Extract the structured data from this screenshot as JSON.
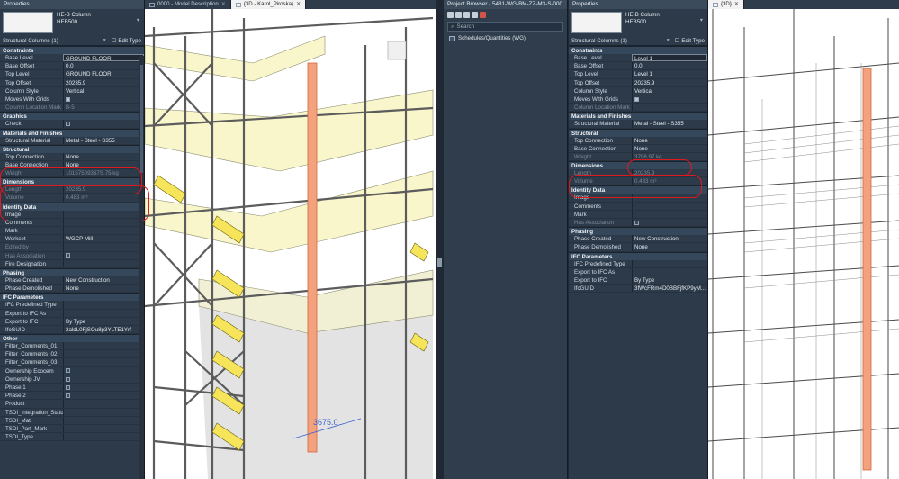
{
  "left_props": {
    "title": "Properties",
    "type_name": "HE-B Column",
    "type_sub": "HEB500",
    "filter": "Structural Columns (1)",
    "edit_type": "Edit Type",
    "sections": [
      {
        "name": "Constraints",
        "rows": [
          {
            "k": "Base Level",
            "v": "GROUND FLOOR",
            "boxed": true
          },
          {
            "k": "Base Offset",
            "v": "0.0"
          },
          {
            "k": "Top Level",
            "v": "GROUND FLOOR"
          },
          {
            "k": "Top Offset",
            "v": "20235.9"
          },
          {
            "k": "Column Style",
            "v": "Vertical"
          },
          {
            "k": "Moves With Grids",
            "v": "",
            "check": true
          },
          {
            "k": "Column Location Mark",
            "v": "B-5",
            "dim": true
          }
        ]
      },
      {
        "name": "Graphics",
        "rows": [
          {
            "k": "Check",
            "v": "",
            "check": false
          }
        ]
      },
      {
        "name": "Materials and Finishes",
        "rows": [
          {
            "k": "Structural Material",
            "v": "Metal - Steel - S355"
          }
        ]
      },
      {
        "name": "Structural",
        "rows": [
          {
            "k": "Top Connection",
            "v": "None"
          },
          {
            "k": "Base Connection",
            "v": "None"
          },
          {
            "k": "Weight",
            "v": "10157509367S.75 kg",
            "dim": true
          }
        ]
      },
      {
        "name": "Dimensions",
        "rows": [
          {
            "k": "Length",
            "v": "20235.9",
            "dim": true
          },
          {
            "k": "Volume",
            "v": "0.483 m³",
            "dim": true
          }
        ]
      },
      {
        "name": "Identity Data",
        "rows": [
          {
            "k": "Image",
            "v": ""
          },
          {
            "k": "Comments",
            "v": ""
          },
          {
            "k": "Mark",
            "v": ""
          },
          {
            "k": "Workset",
            "v": "WGCP Mill"
          },
          {
            "k": "Edited by",
            "v": "",
            "dim": true
          },
          {
            "k": "Has Association",
            "v": "",
            "check": false,
            "dim": true
          },
          {
            "k": "Fire Designation",
            "v": ""
          }
        ]
      },
      {
        "name": "Phasing",
        "rows": [
          {
            "k": "Phase Created",
            "v": "New Construction"
          },
          {
            "k": "Phase Demolished",
            "v": "None"
          }
        ]
      },
      {
        "name": "IFC Parameters",
        "rows": [
          {
            "k": "IFC Predefined Type",
            "v": ""
          },
          {
            "k": "Export to IFC As",
            "v": ""
          },
          {
            "k": "Export to IFC",
            "v": "By Type"
          },
          {
            "k": "IfcGUID",
            "v": "2aldL0FjSOu8p3YLTE1Yrf"
          }
        ]
      },
      {
        "name": "Other",
        "rows": [
          {
            "k": "Filter_Comments_01",
            "v": ""
          },
          {
            "k": "Filter_Comments_02",
            "v": ""
          },
          {
            "k": "Filter_Comments_03",
            "v": ""
          },
          {
            "k": "Ownership Ecocem",
            "v": "",
            "check": false
          },
          {
            "k": "Ownership JV",
            "v": "",
            "check": false
          },
          {
            "k": "Phase 1",
            "v": "",
            "check": false
          },
          {
            "k": "Phase 2",
            "v": "",
            "check": false
          },
          {
            "k": "Product",
            "v": ""
          },
          {
            "k": "TSDI_Integration_Status",
            "v": ""
          },
          {
            "k": "TSDI_Matl",
            "v": ""
          },
          {
            "k": "TSDI_Part_Mark",
            "v": ""
          },
          {
            "k": "TSDI_Type",
            "v": ""
          }
        ]
      }
    ]
  },
  "right_props": {
    "title": "Properties",
    "type_name": "HE-B Column",
    "type_sub": "HEB500",
    "filter": "Structural Columns (1)",
    "edit_type": "Edit Type",
    "sections": [
      {
        "name": "Constraints",
        "rows": [
          {
            "k": "Base Level",
            "v": "Level 1",
            "boxed": true
          },
          {
            "k": "Base Offset",
            "v": "0.0"
          },
          {
            "k": "Top Level",
            "v": "Level 1"
          },
          {
            "k": "Top Offset",
            "v": "20235.9"
          },
          {
            "k": "Column Style",
            "v": "Vertical"
          },
          {
            "k": "Moves With Grids",
            "v": "",
            "check": true
          },
          {
            "k": "Column Location Mark",
            "v": "",
            "dim": true
          }
        ]
      },
      {
        "name": "Materials and Finishes",
        "rows": [
          {
            "k": "Structural Material",
            "v": "Metal - Steel - S355"
          }
        ]
      },
      {
        "name": "Structural",
        "rows": [
          {
            "k": "Top Connection",
            "v": "None"
          },
          {
            "k": "Base Connection",
            "v": "None"
          },
          {
            "k": "Weight",
            "v": "3796.97 kg",
            "dim": true
          }
        ]
      },
      {
        "name": "Dimensions",
        "rows": [
          {
            "k": "Length",
            "v": "20235.9",
            "dim": true
          },
          {
            "k": "Volume",
            "v": "0.483 m³",
            "dim": true
          }
        ]
      },
      {
        "name": "Identity Data",
        "rows": [
          {
            "k": "Image",
            "v": ""
          },
          {
            "k": "Comments",
            "v": ""
          },
          {
            "k": "Mark",
            "v": ""
          },
          {
            "k": "Has Association",
            "v": "",
            "check": false,
            "dim": true
          }
        ]
      },
      {
        "name": "Phasing",
        "rows": [
          {
            "k": "Phase Created",
            "v": "New Construction"
          },
          {
            "k": "Phase Demolished",
            "v": "None"
          }
        ]
      },
      {
        "name": "IFC Parameters",
        "rows": [
          {
            "k": "IFC Predefined Type",
            "v": ""
          },
          {
            "k": "Export to IFC As",
            "v": ""
          },
          {
            "k": "Export to IFC",
            "v": "By Type"
          },
          {
            "k": "IfcGUID",
            "v": "3fWcFRm4D0BBFjfKP9yM..."
          }
        ]
      }
    ]
  },
  "left_view": {
    "tabs": [
      {
        "label": "0000 - Model Description",
        "active": false
      },
      {
        "label": "{3D - Karol_Piroska}",
        "active": true
      }
    ],
    "dimension": "3675.0"
  },
  "browser": {
    "title": "Project Browser - 5481-WG-BM-ZZ-M3-S-000...",
    "search_placeholder": "Search",
    "items": [
      "Schedules/Quantities (WG)"
    ]
  },
  "right_view": {
    "tabs": [
      {
        "label": "{3D}",
        "active": true
      }
    ]
  },
  "colors": {
    "panel": "#2c3a49",
    "highlight_column": "#f4a27e",
    "stairs": "#f6e55a",
    "slab": "#f9f6cc",
    "annotation": "#e0191e"
  }
}
